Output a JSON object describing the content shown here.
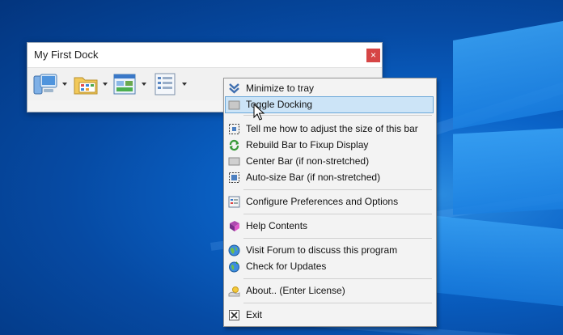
{
  "window": {
    "title": "My First Dock",
    "close_glyph": "×"
  },
  "toolbar": {
    "buttons": [
      {
        "name": "my-computer-icon"
      },
      {
        "name": "folders-icon"
      },
      {
        "name": "control-panel-icon"
      },
      {
        "name": "list-view-icon"
      }
    ]
  },
  "menu": {
    "items": [
      {
        "label": "Minimize to tray",
        "icon": "double-chevron-down-icon"
      },
      {
        "label": "Toggle Docking",
        "icon": "dock-toggle-icon",
        "selected": true
      },
      {
        "label": "Tell me how to adjust the size of this bar",
        "icon": "resize-frame-icon"
      },
      {
        "label": "Rebuild Bar to Fixup Display",
        "icon": "rebuild-arrows-icon"
      },
      {
        "label": "Center Bar (if non-stretched)",
        "icon": "center-bar-icon"
      },
      {
        "label": "Auto-size Bar (if non-stretched)",
        "icon": "autosize-frame-icon"
      },
      {
        "label": "Configure Preferences and Options",
        "icon": "preferences-icon"
      },
      {
        "label": "Help Contents",
        "icon": "help-book-icon"
      },
      {
        "label": "Visit Forum to discuss this program",
        "icon": "globe-icon"
      },
      {
        "label": "Check for Updates",
        "icon": "update-globe-icon"
      },
      {
        "label": "About.. (Enter License)",
        "icon": "about-sun-icon"
      },
      {
        "label": "Exit",
        "icon": "exit-x-icon"
      }
    ]
  },
  "colors": {
    "accent": "#cce4f7",
    "desktop": "#0a63c8",
    "close": "#d64545"
  }
}
